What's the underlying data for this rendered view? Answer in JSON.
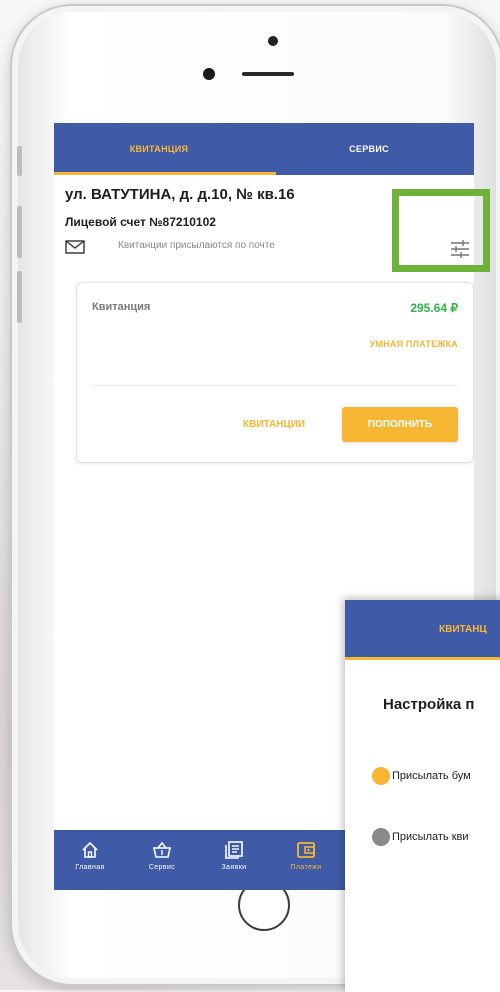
{
  "tabs": {
    "receipt": "КВИТАНЦИЯ",
    "service": "СЕРВИС"
  },
  "account": {
    "address": "ул. ВАТУТИНА, д. д.10, № кв.16",
    "number_label": "Лицевой счет №87210102",
    "delivery_text": "Квитанции присылаются по почте"
  },
  "card": {
    "label": "Квитанция",
    "amount": "295.64 ₽",
    "smart_pay": "УМНАЯ ПЛАТЕЖКА",
    "receipts_link": "КВИТАНЦИИ",
    "topup_button": "ПОПОЛНИТЬ"
  },
  "bottom_nav": [
    {
      "label": "Главная",
      "icon": "home-icon"
    },
    {
      "label": "Сервис",
      "icon": "basket-icon"
    },
    {
      "label": "Заявки",
      "icon": "requests-icon"
    },
    {
      "label": "Платежи",
      "icon": "wallet-icon"
    }
  ],
  "overlay": {
    "tab": "КВИТАНЦ",
    "title": "Настройка п",
    "option_paper": "Присылать бум",
    "option_electronic": "Присылать кви"
  },
  "colors": {
    "primary": "#3f5aa6",
    "accent": "#f7b733",
    "amount": "#34b24a",
    "highlight": "#6fb23a",
    "inactive_dot": "#8a8a8a"
  }
}
